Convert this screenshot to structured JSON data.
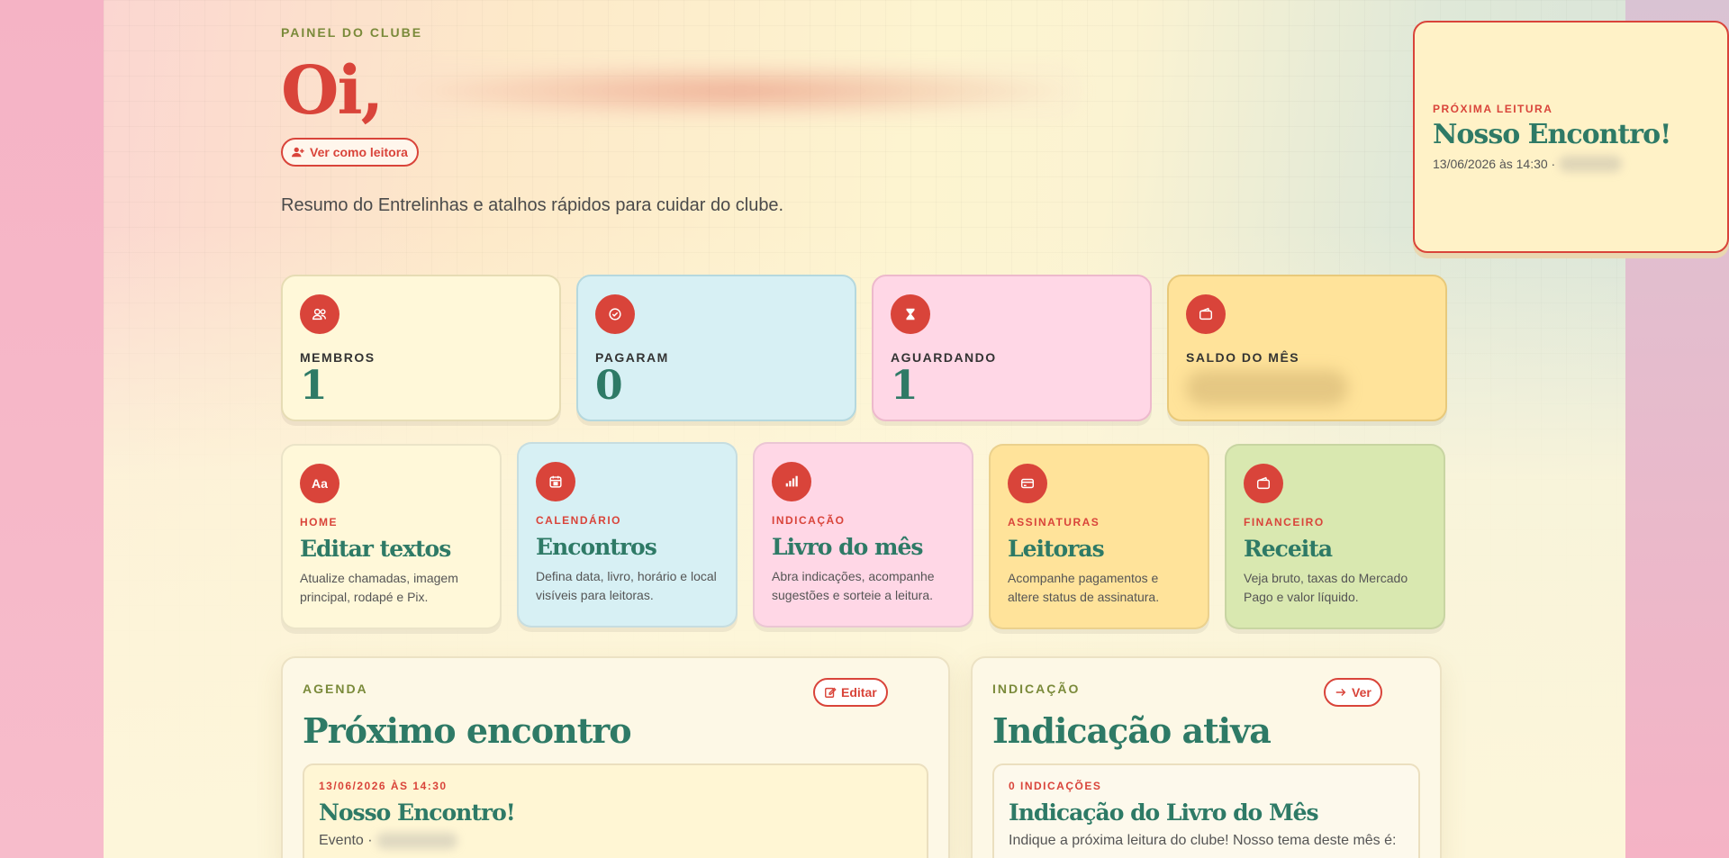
{
  "header": {
    "eyebrow": "PAINEL DO CLUBE",
    "greeting": "Oi,",
    "view_as_label": "Ver como leitora",
    "subtitle": "Resumo do Entrelinhas e atalhos rápidos para cuidar do clube."
  },
  "next_reading": {
    "label": "PRÓXIMA LEITURA",
    "title": "Nosso Encontro!",
    "meta": "13/06/2026 às 14:30 ·"
  },
  "stats": [
    {
      "label": "MEMBROS",
      "value": "1",
      "icon": "users-icon"
    },
    {
      "label": "PAGARAM",
      "value": "0",
      "icon": "check-circle-icon"
    },
    {
      "label": "AGUARDANDO",
      "value": "1",
      "icon": "hourglass-icon"
    },
    {
      "label": "SALDO DO MÊS",
      "value": "",
      "icon": "wallet-icon"
    }
  ],
  "shortcuts": [
    {
      "category": "HOME",
      "title": "Editar textos",
      "description": "Atualize chamadas, imagem principal, rodapé e Pix.",
      "icon": "text-icon",
      "icon_text": "Aa"
    },
    {
      "category": "CALENDÁRIO",
      "title": "Encontros",
      "description": "Defina data, livro, horário e local visíveis para leitoras.",
      "icon": "calendar-icon"
    },
    {
      "category": "INDICAÇÃO",
      "title": "Livro do mês",
      "description": "Abra indicações, acompanhe sugestões e sorteie a leitura.",
      "icon": "bar-chart-icon"
    },
    {
      "category": "ASSINATURAS",
      "title": "Leitoras",
      "description": "Acompanhe pagamentos e altere status de assinatura.",
      "icon": "credit-card-icon"
    },
    {
      "category": "FINANCEIRO",
      "title": "Receita",
      "description": "Veja bruto, taxas do Mercado Pago e valor líquido.",
      "icon": "wallet-icon"
    }
  ],
  "agenda": {
    "eyebrow": "AGENDA",
    "title": "Próximo encontro",
    "edit_label": "Editar",
    "event_date": "13/06/2026 ÀS 14:30",
    "event_title": "Nosso Encontro!",
    "event_meta": "Evento ·"
  },
  "indication": {
    "eyebrow": "INDICAÇÃO",
    "title": "Indicação ativa",
    "view_label": "Ver",
    "count": "0 INDICAÇÕES",
    "card_title": "Indicação do Livro do Mês",
    "card_text": "Indique a próxima leitura do clube! Nosso tema deste mês é:"
  },
  "colors": {
    "accent": "#d9443a",
    "title_green": "#2e7a66",
    "eyebrow_olive": "#7a8a3a"
  }
}
